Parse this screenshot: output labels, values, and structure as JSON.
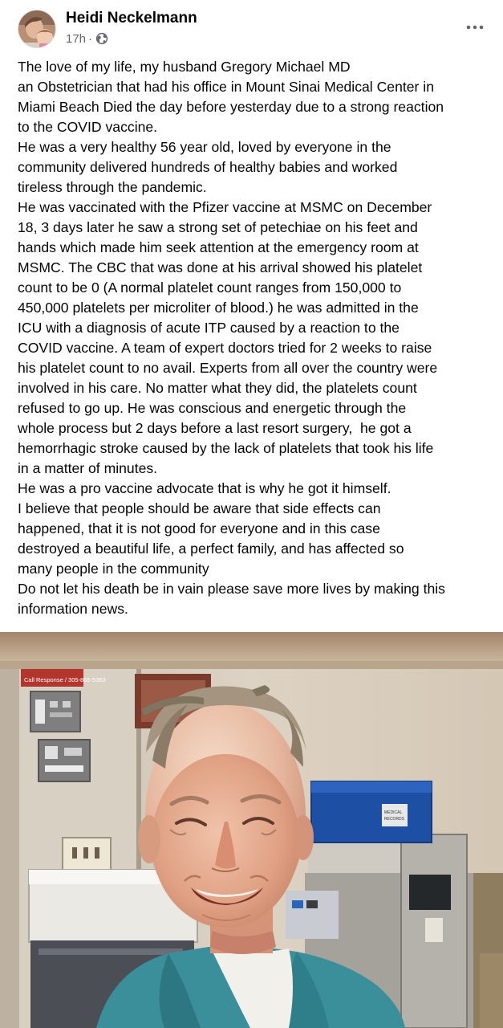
{
  "post": {
    "author": "Heidi Neckelmann",
    "timestamp": "17h",
    "separator": "·",
    "privacy_icon": "globe-icon",
    "more_icon": "more-horizontal-icon",
    "text_lines": [
      "The love of my life, my husband Gregory Michael MD",
      "an Obstetrician that had his office in Mount Sinai Medical Center in",
      "Miami Beach Died the day before yesterday due to a strong reaction",
      "to the COVID vaccine.",
      "He was a very healthy 56 year old, loved by everyone in the",
      "community delivered hundreds of healthy babies and worked",
      "tireless through the pandemic.",
      "He was vaccinated with the Pfizer vaccine at MSMC on December",
      "18, 3 days later he saw a strong set of petechiae on his feet and",
      "hands which made him seek attention at the emergency room at",
      "MSMC. The CBC that was done at his arrival showed his platelet",
      "count to be 0 (A normal platelet count ranges from 150,000 to",
      "450,000 platelets per microliter of blood.) he was admitted in the",
      "ICU with a diagnosis of acute ITP caused by a reaction to the",
      "COVID vaccine. A team of expert doctors tried for 2 weeks to raise",
      "his platelet count to no avail. Experts from all over the country were",
      "involved in his care. No matter what they did, the platelets count",
      "refused to go up. He was conscious and energetic through the",
      "whole process but 2 days before a last resort surgery,  he got a",
      "hemorrhagic stroke caused by the lack of platelets that took his life",
      "in a matter of minutes.",
      "He was a pro vaccine advocate that is why he got it himself.",
      "I believe that people should be aware that side effects can",
      "happened, that it is not good for everyone and in this case",
      "destroyed a beautiful life, a perfect family, and has affected so",
      "many people in the community",
      "Do not let his death be in vain please save more lives by making this",
      "information news."
    ]
  },
  "photo": {
    "wall_sign": "Call Response / 305-865-5363",
    "box_label": "MEDICAL RECORDS"
  }
}
